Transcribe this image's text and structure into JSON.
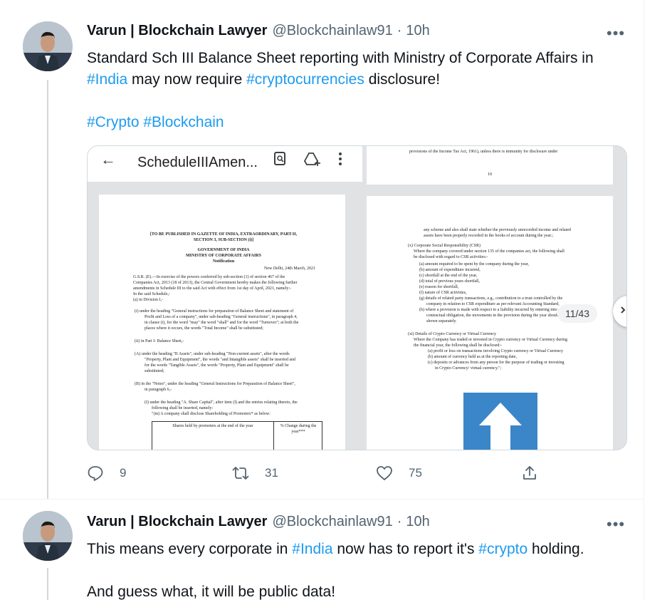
{
  "tweets": [
    {
      "author_name": "Varun | Blockchain Lawyer",
      "handle": "@Blockchainlaw91",
      "separator": "·",
      "time": "10h",
      "more": "•••",
      "text_line1_a": "Standard Sch III Balance Sheet reporting with Ministry of Corporate Affairs in",
      "text_line2_tag1": "#India",
      "text_line2_mid": " may now require ",
      "text_line2_tag2": "#cryptocurrencies",
      "text_line2_end": " disclosure!",
      "tags_line_1": "#Crypto",
      "tags_line_2": "#Blockchain",
      "actions": {
        "replies": "9",
        "retweets": "31",
        "likes": "75"
      }
    },
    {
      "author_name": "Varun | Blockchain Lawyer",
      "handle": "@Blockchainlaw91",
      "separator": "·",
      "time": "10h",
      "more": "•••",
      "text_a": "This means every corporate in ",
      "text_tag1": "#India",
      "text_b": " now has to report it's ",
      "text_tag2": "#crypto",
      "text_c": " holding.",
      "text_line2": "And guess what, it will be public data!"
    }
  ],
  "media": {
    "pdf_title": "ScheduleIIIAmen...",
    "page_counter": "11/43",
    "left_page": {
      "gazette_header": "[TO BE PUBLISHED IN GAZETTE OF INDIA, EXTRAORDINARY, PART-II,",
      "gazette_header2": "SECTION 3, SUB-SECTION (i)]",
      "gov": "GOVERNMENT OF INDIA",
      "ministry": "MINISTRY OF CORPORATE AFFAIRS",
      "notification": "Notification",
      "date": "New Delhi, 24th March, 2021",
      "p1": "G.S.R. (E).—In exercise of the powers conferred by sub-section (1) of section 467 of the",
      "p2": "Companies Act, 2013 (18 of 2013), the Central Government hereby makes the following further",
      "p3": "amendments in Schedule III to the said Act with effect from 1st day of April, 2021, namely:-",
      "p4": "In the said Schedule,-",
      "p5": "(a) in Division I,-",
      "i1": "(i) under the heading \"General instructions for preparation of Balance Sheet and statement of",
      "i2": "Profit and Loss of a company\", under sub-heading \"General instructions\", in paragraph 4,",
      "i3": "in clause (i), for the word \"may\" the word \"shall\" and for the word \"Turnover\"; at both the",
      "i4": "places where it occurs, the words \"Total Income\" shall be substituted;",
      "ii": "(ii) in Part I- Balance Sheet,-",
      "A1": "(A) under the heading \"II Assets\", under sub-heading \"Non-current assets\", after the words",
      "A2": "\"Property, Plant and Equipment\", the words \"and Intangible assets\" shall be inserted and",
      "A3": "for the words \"Tangible Assets\", the words \"Property, Plant and Equipment\" shall be",
      "A4": "substituted;",
      "B1": "(B) in the \"Notes\", under the heading \"General Instructions for Preparation of Balance Sheet\",",
      "B2": "in paragraph 6,-",
      "I1": "(I) under the heading \"A. Share Capital\", after item (l) and the entries relating thereto, the",
      "I2": "following shall be inserted, namely:",
      "I3": "\"(m) A company shall disclose Shareholding of Promoters* as below:",
      "table_col1": "Shares held by promoters at the end of the year",
      "table_col2": "% Change during the year***"
    },
    "right_page_top": {
      "l1": "provisions of the Income Tax Act, 1961), unless there is immunity for disclosure under",
      "page_no": "10"
    },
    "right_page": {
      "r1": "any scheme and also shall state whether the previously unrecorded income and related",
      "r2": "assets have been properly recorded in the books of account during the year.;",
      "csr_h": "(x) Corporate Social Responsibility (CSR)",
      "csr1": "Where the company covered under section 135 of the companies act, the following shall",
      "csr2": "be disclosed with regard to CSR activities:-",
      "a": "(a) amount required to be spent by the company during the year,",
      "b": "(b) amount of expenditure incurred,",
      "c": "(c) shortfall at the end of the year,",
      "d": "(d) total of previous years shortfall,",
      "e": "(e) reason for shortfall,",
      "f": "(f) nature of CSR activities,",
      "g1": "(g) details of related party transactions, e.g., contribution to a trust controlled by the",
      "g2": "company in relation to CSR expenditure as per relevant Accounting Standard,",
      "h1": "(h) where a provision is made with respect to a liability incurred by entering into a",
      "h2": "contractual obligation, the movements in the provision during the year should be",
      "h3": "shown separately.",
      "xi_h": "(xi) Details of Crypto Currency or Virtual Currency",
      "xi1": "Where the Company has traded or invested in Crypto currency or Virtual Currency during",
      "xi2": "the financial year, the following shall be disclosed:-",
      "xa": "(a) profit or loss on transactions involving Crypto currency or Virtual Currency",
      "xb": "(b) amount of currency held as at the reporting date,",
      "xc1": "(c) deposits or advances from any person for the purpose of trading or investing",
      "xc2": "in Crypto Currency/ virtual currency.\";"
    }
  },
  "colors": {
    "link": "#1d9bf0",
    "secondary": "#536471",
    "text": "#0f1419"
  },
  "icons": [
    "more-icon",
    "reply-icon",
    "retweet-icon",
    "like-icon",
    "share-icon",
    "back-arrow-icon",
    "search-doc-icon",
    "drive-add-icon",
    "kebab-menu-icon",
    "next-page-icon",
    "upload-arrow-icon"
  ]
}
